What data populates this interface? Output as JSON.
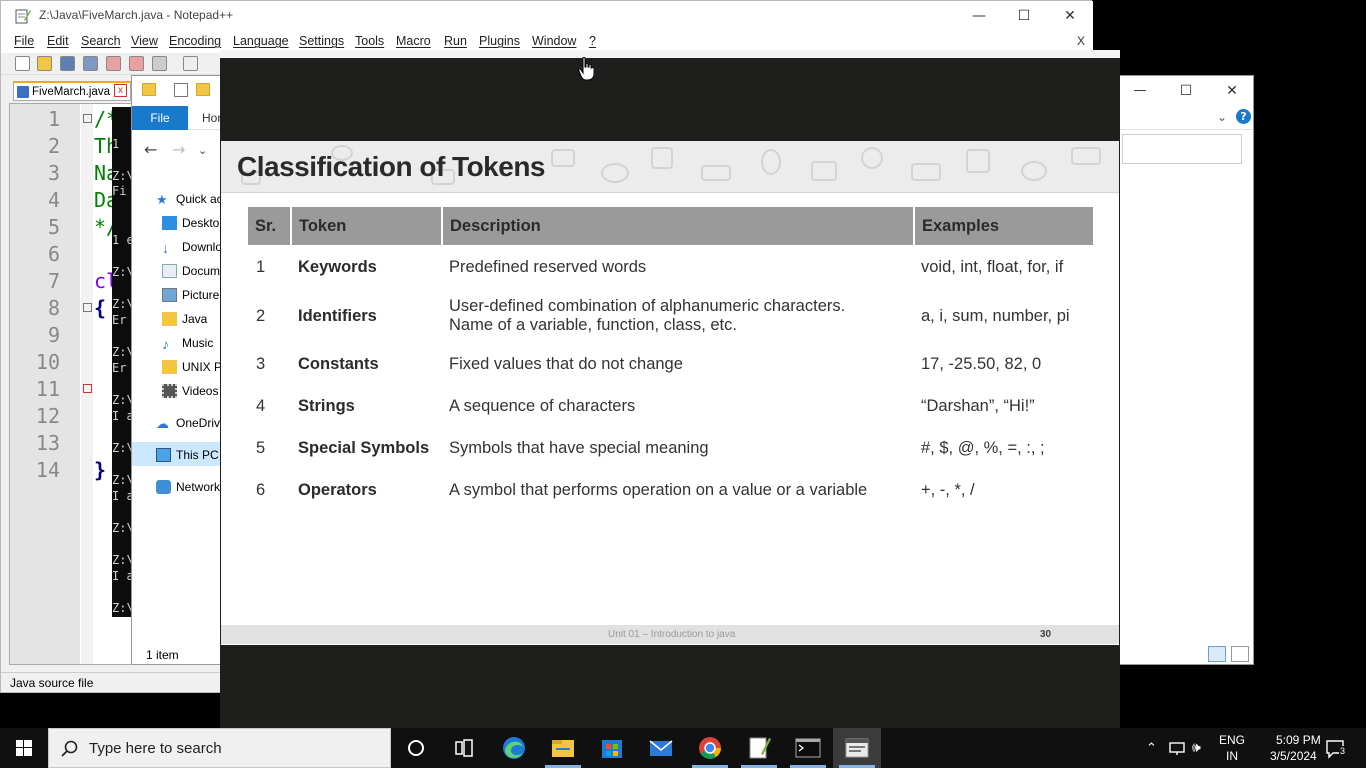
{
  "npp": {
    "title": "Z:\\Java\\FiveMarch.java - Notepad++",
    "menu": [
      "File",
      "Edit",
      "Search",
      "View",
      "Encoding",
      "Language",
      "Settings",
      "Tools",
      "Macro",
      "Run",
      "Plugins",
      "Window",
      "?"
    ],
    "menu_close": "X",
    "tab_label": "FiveMarch.java",
    "tab_close": "x",
    "line_numbers": [
      "1",
      "2",
      "3",
      "4",
      "5",
      "6",
      "7",
      "8",
      "9",
      "10",
      "11",
      "12",
      "13",
      "14"
    ],
    "code_lines": [
      "/*",
      "Th",
      "Na",
      "Da",
      "*/",
      "",
      "cl",
      "{",
      "",
      "",
      "",
      "",
      "",
      "}"
    ],
    "status": "Java source file",
    "window_buttons": {
      "minimize": "—",
      "maximize": "☐",
      "close": "✕"
    }
  },
  "console": {
    "lines": [
      "1 ",
      "Z:\\",
      "Fi",
      "1 e",
      "Z:\\",
      "Z:\\",
      "Er",
      "Z:\\",
      "Er",
      "Z:\\",
      "I a",
      "Z:\\",
      "Z:\\",
      "I a",
      "Z:\\",
      "Z:\\",
      "I a",
      "Z:\\"
    ]
  },
  "explorer": {
    "ribbon_file": "File",
    "ribbon_home": "Hon",
    "nav_items": [
      {
        "label": "Quick ac",
        "icon": "star-icon"
      },
      {
        "label": "Deskto",
        "icon": "desktop-icon"
      },
      {
        "label": "Downlo",
        "icon": "download-icon"
      },
      {
        "label": "Docum",
        "icon": "document-icon"
      },
      {
        "label": "Picture",
        "icon": "picture-icon"
      },
      {
        "label": "Java",
        "icon": "folder-icon"
      },
      {
        "label": "Music",
        "icon": "music-icon"
      },
      {
        "label": "UNIX P",
        "icon": "folder-icon"
      },
      {
        "label": "Videos",
        "icon": "video-icon"
      },
      {
        "label": "OneDriv",
        "icon": "cloud-icon"
      },
      {
        "label": "This PC",
        "icon": "computer-icon"
      },
      {
        "label": "Network",
        "icon": "network-icon"
      }
    ],
    "status": "1 item",
    "help": "?"
  },
  "slide": {
    "title": "Classification of Tokens",
    "headers": [
      "Sr.",
      "Token",
      "Description",
      "Examples"
    ],
    "rows": [
      {
        "sr": "1",
        "token": "Keywords",
        "desc": [
          "Predefined reserved words"
        ],
        "examples": "void, int, float, for, if"
      },
      {
        "sr": "2",
        "token": "Identifiers",
        "desc": [
          "User-defined combination of alphanumeric characters.",
          "Name of a variable, function, class, etc."
        ],
        "examples": "a, i, sum, number, pi"
      },
      {
        "sr": "3",
        "token": "Constants",
        "desc": [
          "Fixed values that do not change"
        ],
        "examples": "17, -25.50, 82, 0"
      },
      {
        "sr": "4",
        "token": "Strings",
        "desc": [
          "A sequence of characters"
        ],
        "examples": "“Darshan”, “Hi!”"
      },
      {
        "sr": "5",
        "token": "Special Symbols",
        "desc": [
          "Symbols that have special meaning"
        ],
        "examples": "#, $, @, %, =, :, ;"
      },
      {
        "sr": "6",
        "token": "Operators",
        "desc": [
          "A symbol that performs operation on a value or a variable"
        ],
        "examples": "+, -, *, /"
      }
    ],
    "footer": "Unit 01 – Introduction to java",
    "page": "30"
  },
  "taskbar": {
    "search_placeholder": "Type here to search",
    "apps": [
      "cortana-icon",
      "task-view-icon",
      "edge-icon",
      "file-explorer-icon",
      "store-icon",
      "mail-icon",
      "chrome-icon",
      "notepadpp-icon",
      "terminal-icon",
      "document-viewer-icon"
    ],
    "lang_top": "ENG",
    "lang_bottom": "IN",
    "time": "5:09 PM",
    "date": "3/5/2024",
    "notif_count": "3"
  }
}
